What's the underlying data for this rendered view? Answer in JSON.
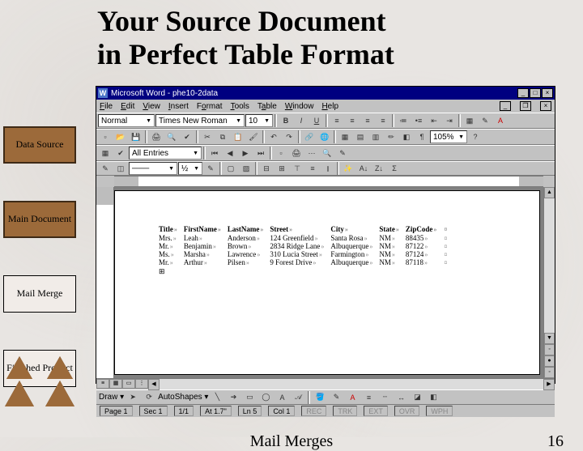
{
  "slide": {
    "title_line1": "Your Source Document",
    "title_line2": "in Perfect Table Format",
    "footer_label": "Mail Merges",
    "page_number": "16"
  },
  "nav": {
    "data_source": "Data Source",
    "main_document": "Main Document",
    "mail_merge": "Mail Merge",
    "finished_product": "Finished Product"
  },
  "word": {
    "title": "Microsoft Word - phe10-2data",
    "menus": [
      "File",
      "Edit",
      "View",
      "Insert",
      "Format",
      "Tools",
      "Table",
      "Window",
      "Help"
    ],
    "style_combo": "Normal",
    "font_combo": "Times New Roman",
    "size_combo": "10",
    "zoom": "105%",
    "merge_combo": "All Entries",
    "draw_label": "Draw",
    "autoshapes_label": "AutoShapes",
    "status": {
      "page": "Page 1",
      "sec": "Sec 1",
      "pages": "1/1",
      "at": "At 1.7\"",
      "ln": "Ln 5",
      "col": "Col 1",
      "modes": [
        "REC",
        "TRK",
        "EXT",
        "OVR",
        "WPH"
      ]
    },
    "table": {
      "headers": [
        "Title",
        "FirstName",
        "LastName",
        "Street",
        "City",
        "State",
        "ZipCode"
      ],
      "rows": [
        [
          "Mrs.",
          "Leah",
          "Anderson",
          "124 Greenfield",
          "Santa Rosa",
          "NM",
          "88435"
        ],
        [
          "Mr.",
          "Benjamin",
          "Brown",
          "2834 Ridge Lane",
          "Albuquerque",
          "NM",
          "87122"
        ],
        [
          "Ms.",
          "Marsha",
          "Lawrence",
          "310 Lucia Street",
          "Farmington",
          "NM",
          "87124"
        ],
        [
          "Mr.",
          "Arthur",
          "Pilsen",
          "9 Forest Drive",
          "Albuquerque",
          "NM",
          "87118"
        ]
      ]
    }
  }
}
